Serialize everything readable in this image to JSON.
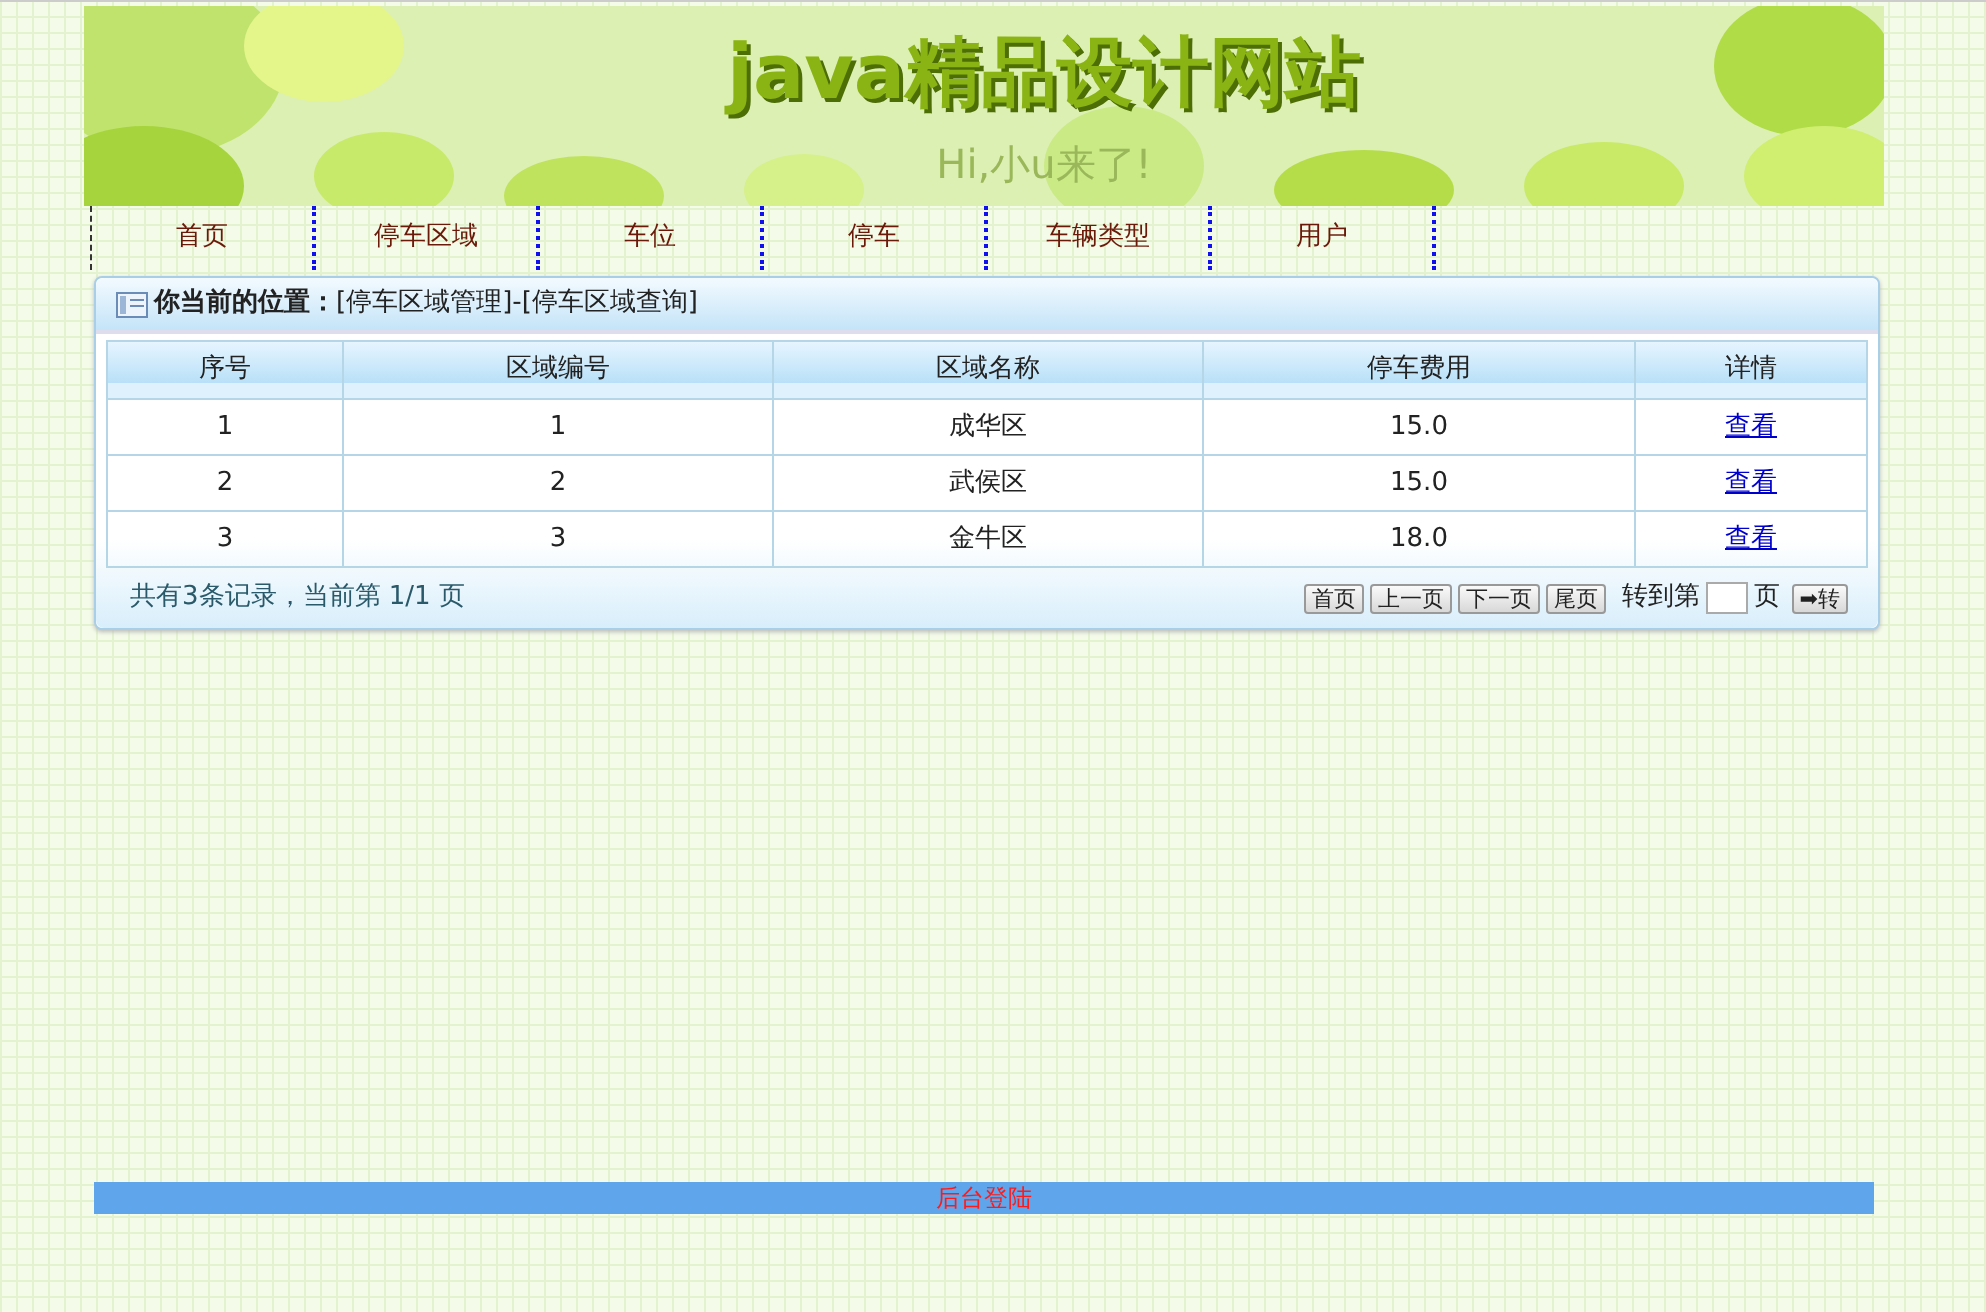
{
  "banner": {
    "title": "java精品设计网站",
    "subtitle": "Hi,小u来了!"
  },
  "nav": [
    {
      "label": "首页"
    },
    {
      "label": "停车区域"
    },
    {
      "label": "车位"
    },
    {
      "label": "停车"
    },
    {
      "label": "车辆类型"
    },
    {
      "label": "用户"
    }
  ],
  "breadcrumb": {
    "label": "你当前的位置：",
    "path": "[停车区域管理]-[停车区域查询]"
  },
  "table": {
    "columns": [
      "序号",
      "区域编号",
      "区域名称",
      "停车费用",
      "详情"
    ],
    "rows": [
      [
        "1",
        "1",
        "成华区",
        "15.0",
        "查看"
      ],
      [
        "2",
        "2",
        "武侯区",
        "15.0",
        "查看"
      ],
      [
        "3",
        "3",
        "金牛区",
        "18.0",
        "查看"
      ]
    ]
  },
  "pager": {
    "summary": "共有3条记录，当前第 1/1 页",
    "buttons": [
      "首页",
      "上一页",
      "下一页",
      "尾页"
    ],
    "goto_label": "转到第",
    "page_unit": "页",
    "go_button": "➡转"
  },
  "footer": {
    "link": "后台登陆"
  }
}
